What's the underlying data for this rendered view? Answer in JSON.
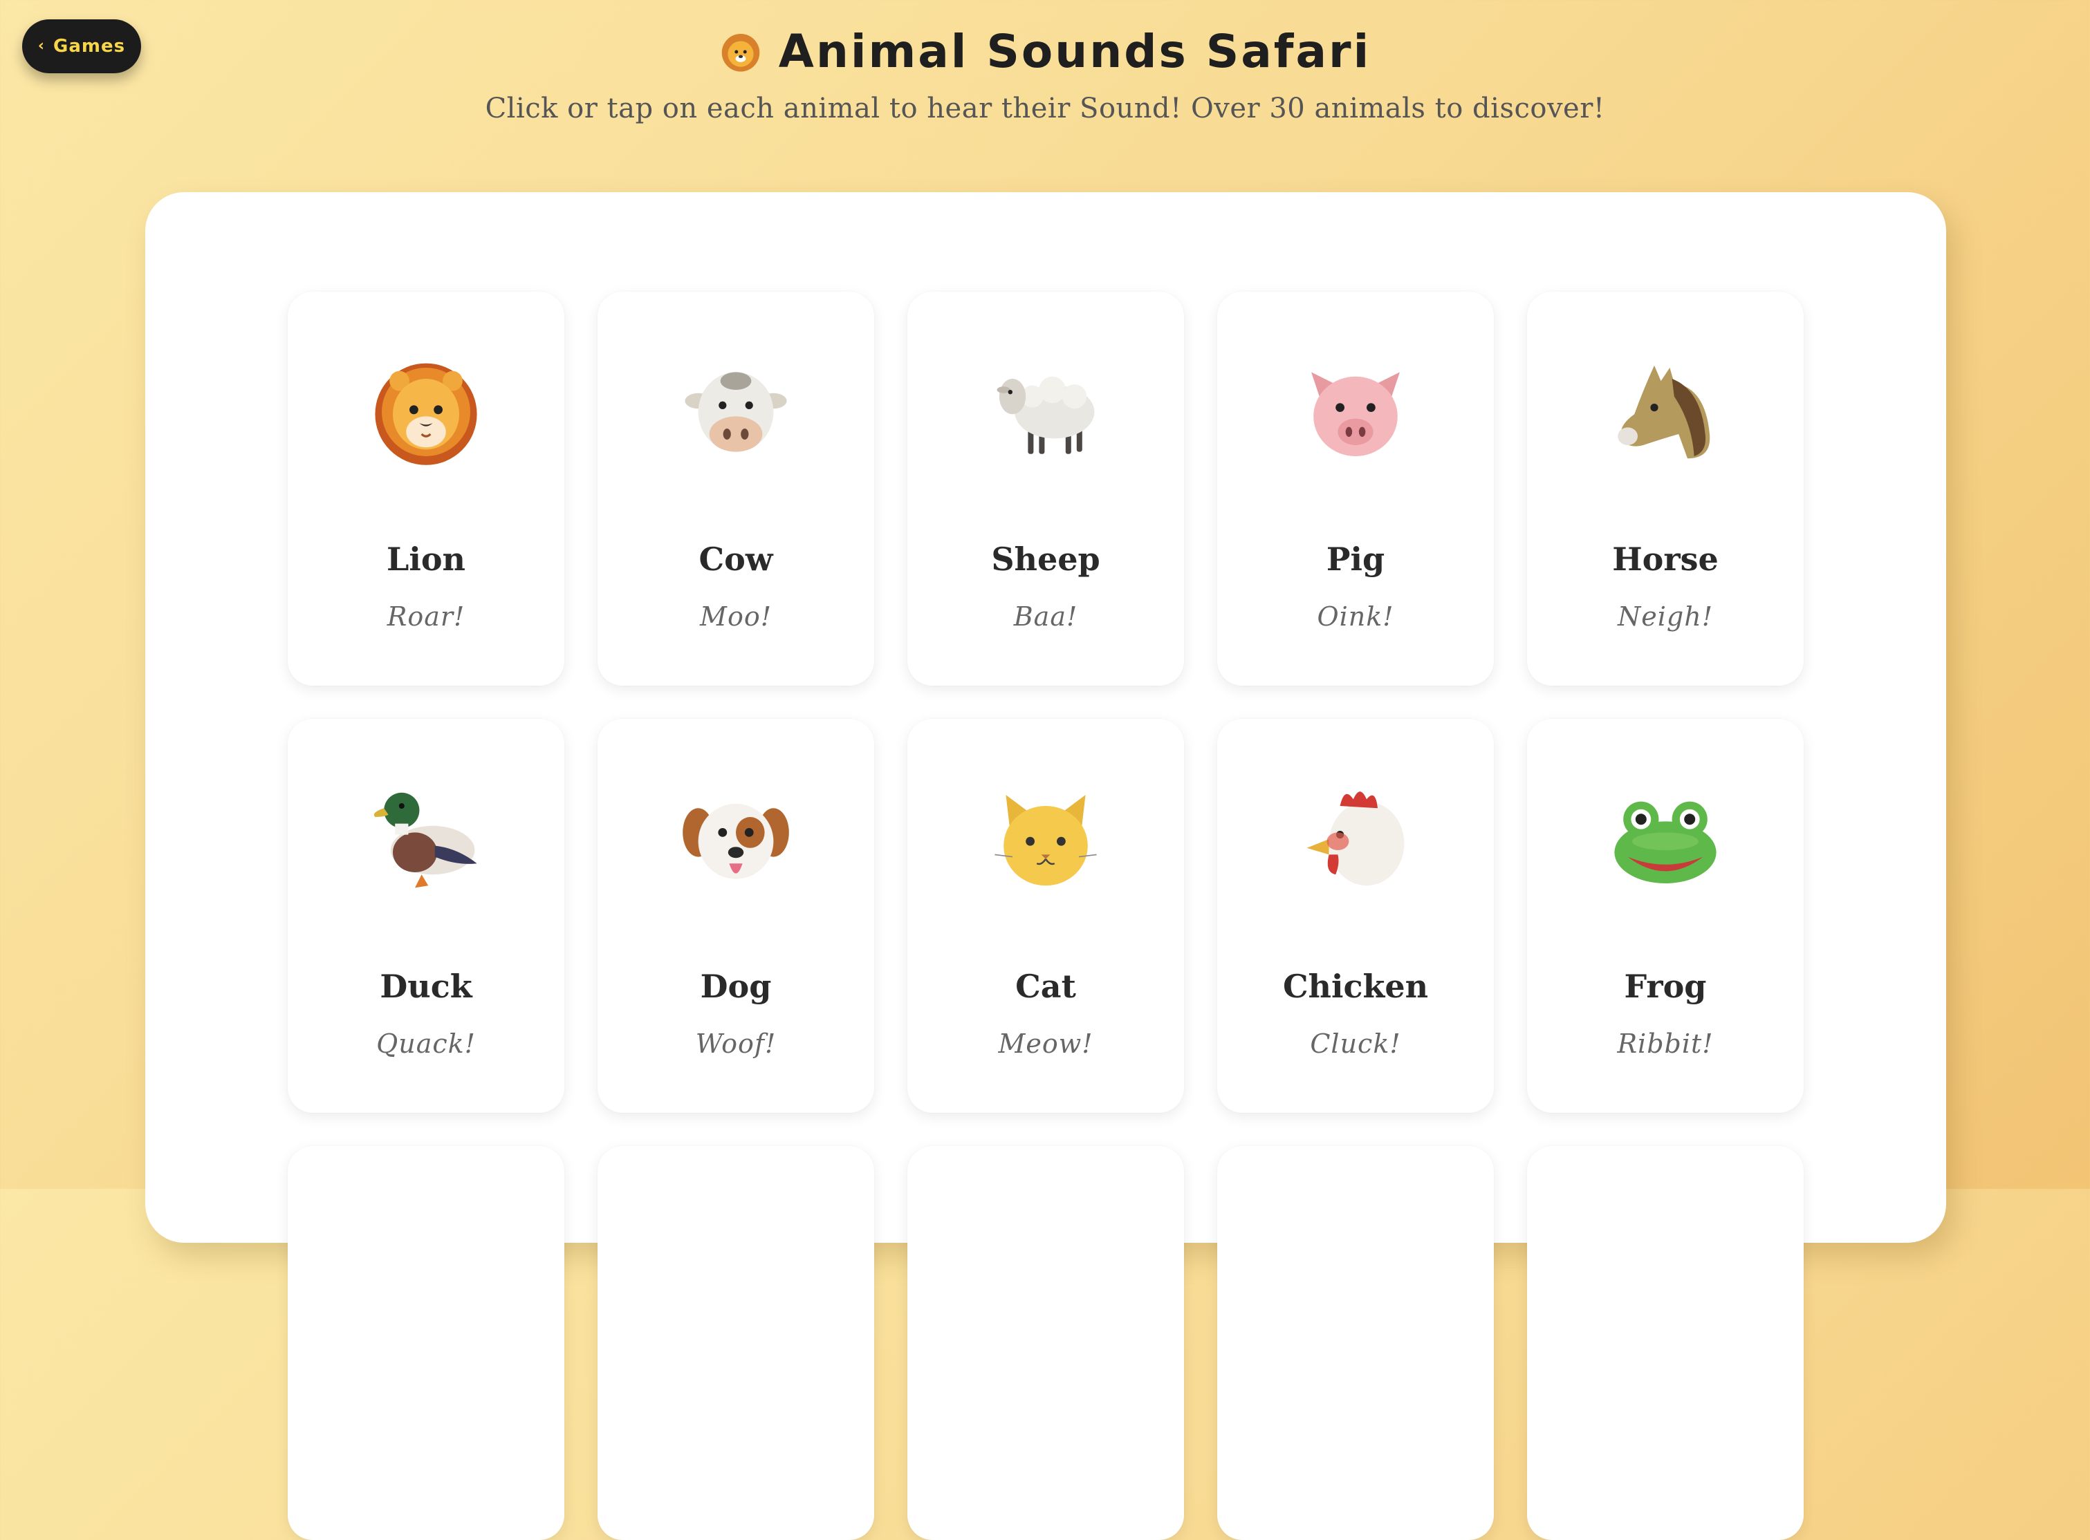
{
  "nav": {
    "back_label": "Games"
  },
  "header": {
    "title": "Animal Sounds Safari",
    "subtitle": "Click or tap on each animal to hear their Sound! Over 30 animals to discover!"
  },
  "animals": [
    {
      "name": "Lion",
      "sound": "Roar!",
      "icon": "lion-icon"
    },
    {
      "name": "Cow",
      "sound": "Moo!",
      "icon": "cow-icon"
    },
    {
      "name": "Sheep",
      "sound": "Baa!",
      "icon": "sheep-icon"
    },
    {
      "name": "Pig",
      "sound": "Oink!",
      "icon": "pig-icon"
    },
    {
      "name": "Horse",
      "sound": "Neigh!",
      "icon": "horse-icon"
    },
    {
      "name": "Duck",
      "sound": "Quack!",
      "icon": "duck-icon"
    },
    {
      "name": "Dog",
      "sound": "Woof!",
      "icon": "dog-icon"
    },
    {
      "name": "Cat",
      "sound": "Meow!",
      "icon": "cat-icon"
    },
    {
      "name": "Chicken",
      "sound": "Cluck!",
      "icon": "chicken-icon"
    },
    {
      "name": "Frog",
      "sound": "Ribbit!",
      "icon": "frog-icon"
    }
  ],
  "colors": {
    "background_start": "#fbe7a6",
    "background_end": "#f2c474",
    "back_button_bg": "#1c1c1c",
    "back_button_text": "#f7d64a"
  }
}
